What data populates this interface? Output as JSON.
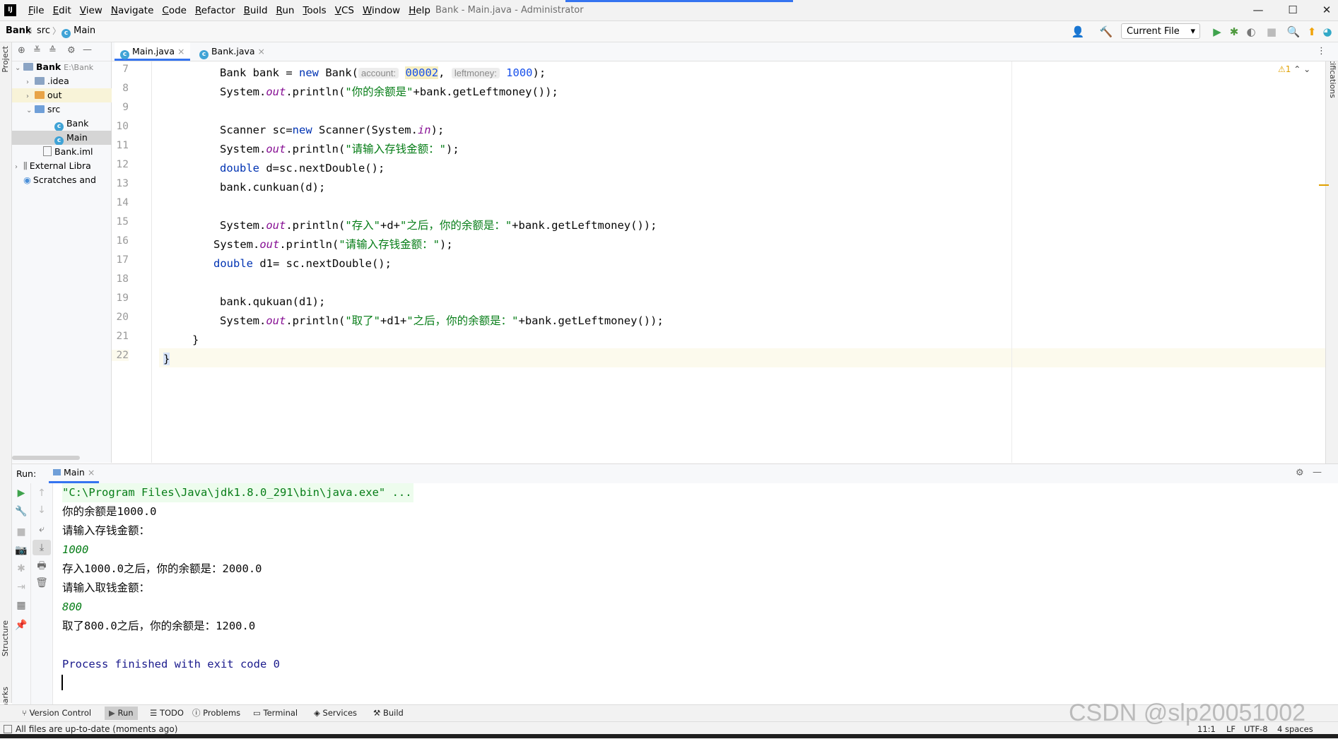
{
  "window": {
    "logo": "IJ",
    "title": "Bank - Main.java - Administrator",
    "menu": [
      "File",
      "Edit",
      "View",
      "Navigate",
      "Code",
      "Refactor",
      "Build",
      "Run",
      "Tools",
      "VCS",
      "Window",
      "Help"
    ],
    "controls": {
      "minimize": "—",
      "maximize": "☐",
      "close": "✕"
    }
  },
  "breadcrumb": {
    "project": "Bank",
    "folder": "src",
    "file": "Main",
    "sep": "〉"
  },
  "toolbar": {
    "run_config": "Current File",
    "run_config_arrow": "▾"
  },
  "left_stripe": {
    "project": "Project",
    "structure": "Structure",
    "bookmarks": "Bookmarks"
  },
  "right_stripe": {
    "notifications": "Notifications"
  },
  "project_tree": [
    {
      "label": "Bank",
      "extra": "E:\\Bank",
      "arrow": "⌄",
      "kind": "project"
    },
    {
      "label": ".idea",
      "arrow": "›",
      "kind": "folder"
    },
    {
      "label": "out",
      "arrow": "›",
      "kind": "folder-orange"
    },
    {
      "label": "src",
      "arrow": "⌄",
      "kind": "folder-blue"
    },
    {
      "label": "Bank",
      "kind": "class"
    },
    {
      "label": "Main",
      "kind": "class"
    },
    {
      "label": "Bank.iml",
      "kind": "file"
    },
    {
      "label": "External Libra",
      "arrow": "›",
      "kind": "lib"
    },
    {
      "label": "Scratches and",
      "kind": "scratch"
    }
  ],
  "editor": {
    "tabs": [
      {
        "label": "Main.java",
        "close": "×"
      },
      {
        "label": "Bank.java",
        "close": "×"
      }
    ],
    "warnings": "⚠1",
    "line_numbers": [
      "7",
      "8",
      "9",
      "10",
      "11",
      "12",
      "13",
      "14",
      "15",
      "16",
      "17",
      "18",
      "19",
      "20",
      "21",
      "22"
    ],
    "hints": {
      "account": "account:",
      "leftmoney": "leftmoney:"
    },
    "tokens": {
      "l7_a": "Bank bank = ",
      "new": "new",
      "l7_b": " Bank(",
      "v_account": "00002",
      ",": ", ",
      "v_left": "1000",
      "l7_c": ");",
      "sysout": "System.",
      "out": "out",
      "println": ".println(",
      "s8": "\"你的余额是\"",
      "l8_c": "+bank.getLeftmoney());",
      "l10_a": "Scanner sc=",
      "l10_b": " Scanner(System.",
      "in": "in",
      "l10_c": ");",
      "s11": "\"请输入存钱金额：\"",
      "close": ");",
      "double": "double",
      "l12": " d=sc.nextDouble();",
      "l13": "bank.cunkuan(d);",
      "s15a": "\"存入\"",
      "l15_b": "+d+",
      "s15b": "\"之后，你的余额是：\"",
      "l15_c": "+bank.getLeftmoney());",
      "l17": " d1= sc.nextDouble();",
      "l19": "bank.qukuan(d1);",
      "s20a": "\"取了\"",
      "l20_b": "+d1+",
      "s20b": "\"之后，你的余额是：\"",
      "l21": "}",
      "l22": "}"
    }
  },
  "run_panel": {
    "label": "Run:",
    "tab": "Main",
    "tab_close": "×",
    "console": [
      {
        "text": "\"C:\\Program Files\\Java\\jdk1.8.0_291\\bin\\java.exe\" ...",
        "kind": "cmd"
      },
      {
        "text": "你的余额是1000.0",
        "kind": "out"
      },
      {
        "text": "请输入存钱金额：",
        "kind": "out"
      },
      {
        "text": "1000",
        "kind": "in"
      },
      {
        "text": "存入1000.0之后，你的余额是：2000.0",
        "kind": "out"
      },
      {
        "text": "请输入取钱金额：",
        "kind": "out"
      },
      {
        "text": "800",
        "kind": "in"
      },
      {
        "text": "取了800.0之后，你的余额是：1200.0",
        "kind": "out"
      },
      {
        "text": "",
        "kind": "out"
      },
      {
        "text": "Process finished with exit code 0",
        "kind": "exit"
      }
    ]
  },
  "bottom_tools": [
    "Version Control",
    "Run",
    "TODO",
    "Problems",
    "Terminal",
    "Services",
    "Build"
  ],
  "status": {
    "message": "All files are up-to-date (moments ago)",
    "position": "11:1",
    "line_sep": "LF",
    "encoding": "UTF-8",
    "indent": "4 spaces"
  },
  "watermark": "CSDN @slp20051002",
  "colors": {
    "accent": "#3574f0",
    "keyword": "#0033b3",
    "string": "#067d17",
    "number": "#1750eb",
    "field": "#871094"
  }
}
